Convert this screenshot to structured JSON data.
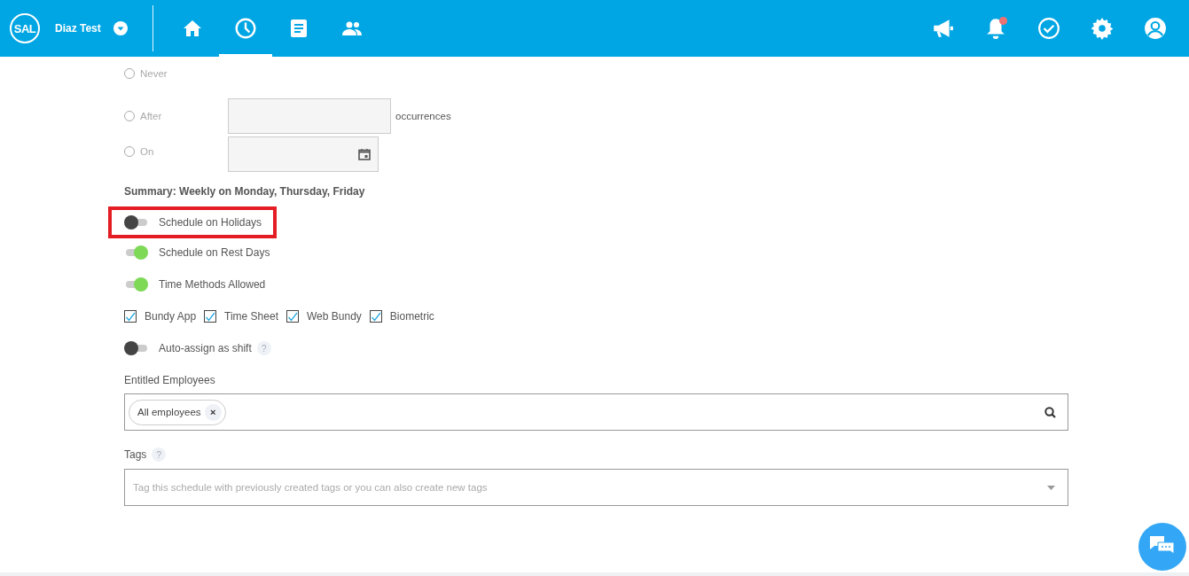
{
  "header": {
    "logo": "SAL",
    "company": "Diaz Test",
    "nav": [
      {
        "kind": "home",
        "selected": false
      },
      {
        "kind": "clock",
        "selected": true
      },
      {
        "kind": "document",
        "selected": false
      },
      {
        "kind": "people",
        "selected": false
      }
    ],
    "actions": [
      {
        "kind": "megaphone",
        "badge": false
      },
      {
        "kind": "bell",
        "badge": true
      },
      {
        "kind": "check",
        "badge": false
      },
      {
        "kind": "gear",
        "badge": false
      },
      {
        "kind": "user",
        "badge": false
      }
    ]
  },
  "end_options": [
    {
      "label": "Never",
      "selected": false,
      "kind": "plain"
    },
    {
      "label": "After",
      "selected": false,
      "kind": "number",
      "suffix": "occurrences"
    },
    {
      "label": "On",
      "selected": false,
      "kind": "date"
    }
  ],
  "summary": "Summary: Weekly on Monday, Thursday, Friday",
  "settings": [
    {
      "kind": "toggle",
      "label": "Schedule on Holidays",
      "on": false,
      "highlighted": true
    },
    {
      "kind": "toggle",
      "label": "Schedule on Rest Days",
      "on": true,
      "highlighted": false
    },
    {
      "kind": "toggle",
      "label": "Time Methods Allowed",
      "on": true,
      "highlighted": false
    },
    {
      "kind": "checkboxes",
      "items": [
        {
          "label": "Bundy App",
          "checked": true
        },
        {
          "label": "Time Sheet",
          "checked": true
        },
        {
          "label": "Web Bundy",
          "checked": true
        },
        {
          "label": "Biometric",
          "checked": true
        }
      ]
    },
    {
      "kind": "toggle",
      "label": "Auto-assign as shift",
      "on": false,
      "highlighted": false,
      "help": "?"
    }
  ],
  "entitled": {
    "label": "Entitled Employees",
    "chips": [
      {
        "label": "All employees",
        "remove": "×"
      }
    ]
  },
  "tags": {
    "label": "Tags",
    "help": "?",
    "placeholder": "Tag this schedule with previously created tags or you can also create new tags"
  }
}
